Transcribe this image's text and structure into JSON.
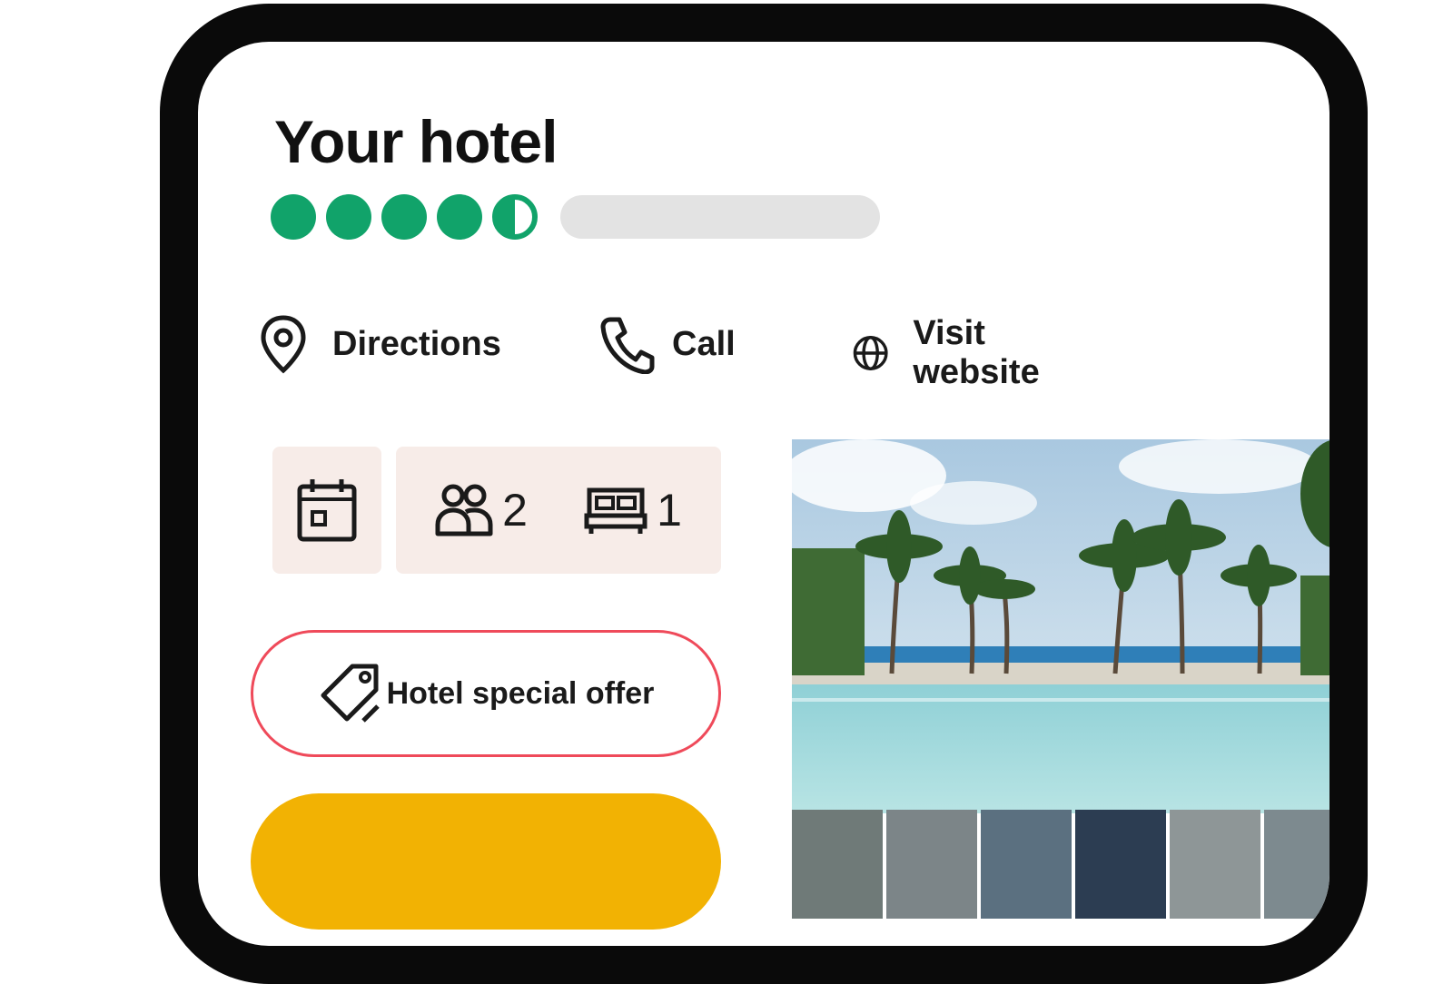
{
  "hotel": {
    "name": "Your hotel",
    "rating": {
      "value": 4.5,
      "max": 5
    }
  },
  "actions": {
    "directions": "Directions",
    "call": "Call",
    "website": "Visit website"
  },
  "booking": {
    "guests": "2",
    "rooms": "1"
  },
  "offer": {
    "label": "Hotel special offer"
  },
  "colors": {
    "rating_green": "#11a36a",
    "offer_border": "#ef4a5a",
    "cta_yellow": "#f2b203",
    "booking_tile": "#f7ece8"
  },
  "icons": {
    "directions": "map-pin-icon",
    "call": "phone-icon",
    "website": "globe-icon",
    "date": "calendar-icon",
    "guests": "people-icon",
    "rooms": "bed-icon",
    "offer": "tag-icon"
  }
}
